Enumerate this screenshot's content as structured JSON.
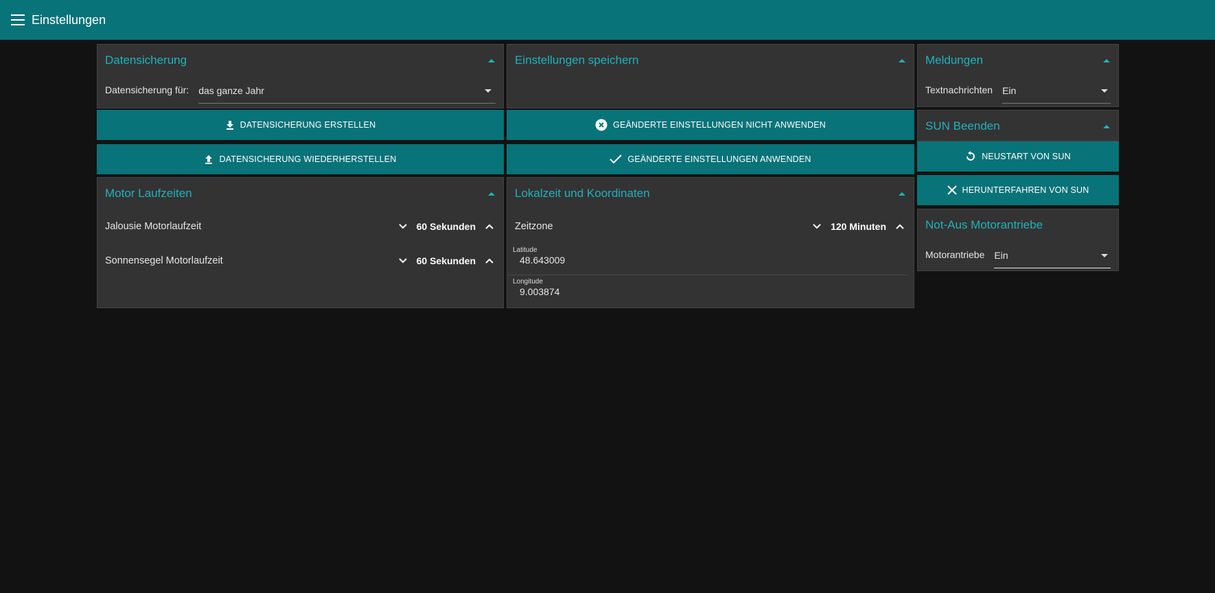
{
  "app": {
    "title": "Einstellungen"
  },
  "datensicherung": {
    "title": "Datensicherung",
    "field_label": "Datensicherung für:",
    "field_value": "das ganze Jahr",
    "create_button": "DATENSICHERUNG ERSTELLEN",
    "restore_button": "DATENSICHERUNG WIEDERHERSTELLEN"
  },
  "einstellungen_speichern": {
    "title": "Einstellungen speichern",
    "discard_button": "GEÄNDERTE EINSTELLUNGEN NICHT ANWENDEN",
    "apply_button": "GEÄNDERTE EINSTELLUNGEN ANWENDEN"
  },
  "meldungen": {
    "title": "Meldungen",
    "field_label": "Textnachrichten",
    "field_value": "Ein"
  },
  "sun_beenden": {
    "title": "SUN Beenden",
    "restart_button": "NEUSTART VON SUN",
    "shutdown_button": "HERUNTERFAHREN VON SUN"
  },
  "motor_laufzeiten": {
    "title": "Motor Laufzeiten",
    "rows": [
      {
        "label": "Jalousie Motorlaufzeit",
        "value": "60 Sekunden"
      },
      {
        "label": "Sonnensegel Motorlaufzeit",
        "value": "60 Sekunden"
      }
    ]
  },
  "lokalzeit": {
    "title": "Lokalzeit und Koordinaten",
    "zeitzone_label": "Zeitzone",
    "zeitzone_value": "120 Minuten",
    "latitude_label": "Latitude",
    "latitude_value": "48.643009",
    "longitude_label": "Longitude",
    "longitude_value": "9.003874"
  },
  "not_aus": {
    "title": "Not-Aus Motorantriebe",
    "field_label": "Motorantriebe",
    "field_value": "Ein"
  },
  "colors": {
    "accent": "#087378",
    "accent_text": "#1fb3bd",
    "panel": "#333333",
    "background": "#121212"
  }
}
